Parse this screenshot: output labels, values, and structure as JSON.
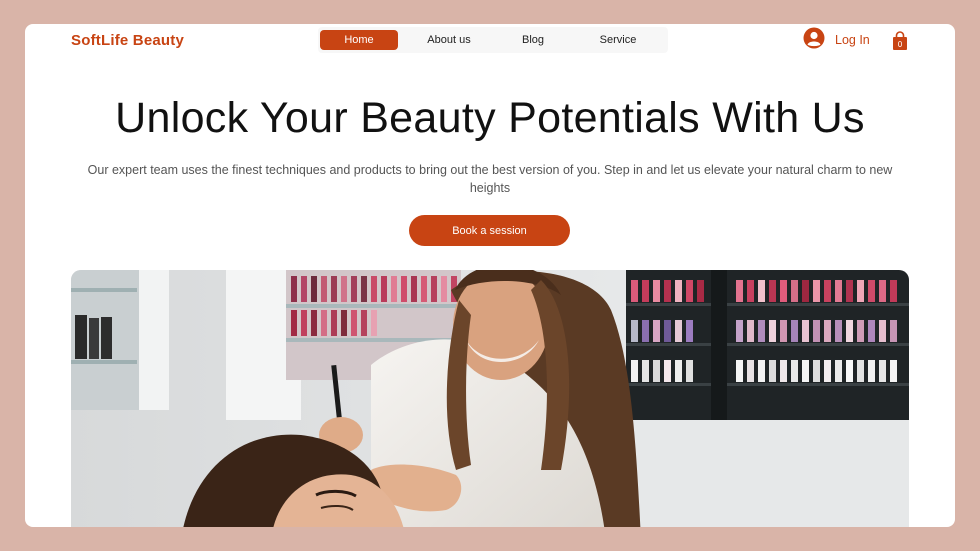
{
  "header": {
    "brand": "SoftLife Beauty",
    "nav": [
      {
        "label": "Home",
        "active": true
      },
      {
        "label": "About us",
        "active": false
      },
      {
        "label": "Blog",
        "active": false
      },
      {
        "label": "Service",
        "active": false
      }
    ],
    "login_label": "Log In",
    "cart_count": "0",
    "icons": {
      "login": "user-avatar-icon",
      "cart": "shopping-bag-icon"
    }
  },
  "hero": {
    "title": "Unlock Your Beauty Potentials With Us",
    "subtitle": "Our expert team uses the finest techniques and products to bring out the best version of you. Step in and let us elevate your natural charm to new heights",
    "cta_label": "Book a session"
  },
  "colors": {
    "accent": "#c84413",
    "page_background": "#d9b4a8",
    "card_background": "#ffffff"
  }
}
